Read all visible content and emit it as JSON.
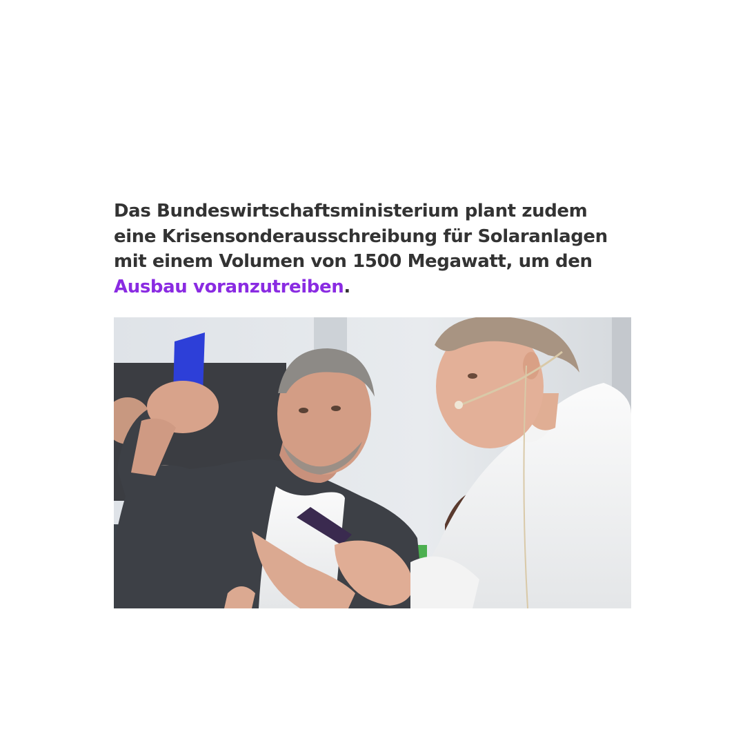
{
  "article": {
    "lead_line_1": "Das Bundeswirtschaftsministerium plant zudem",
    "lead_line_2": "eine Krisensonderausschreibung für Solaranlagen",
    "lead_line_3": "mit einem Volumen von 1500 Megawatt, um den",
    "lead_link": "Ausbau voranzutreiben",
    "lead_end": "."
  },
  "colors": {
    "text": "#333333",
    "link": "#8a2be2",
    "background": "#ffffff"
  }
}
